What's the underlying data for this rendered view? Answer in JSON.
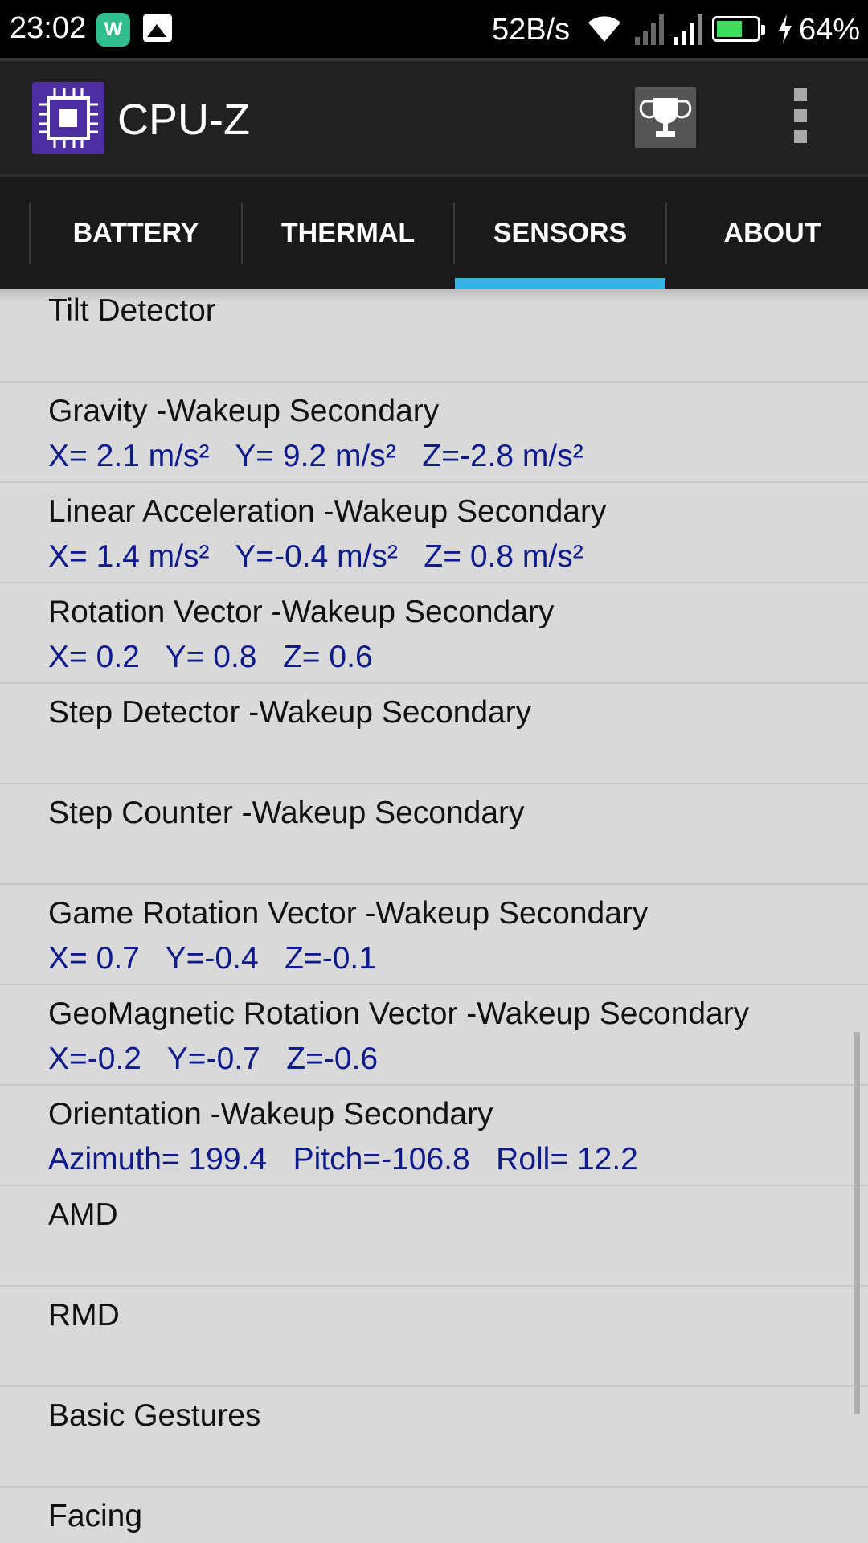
{
  "status_bar": {
    "time": "23:02",
    "network_speed": "52B/s",
    "battery_level": 0.64,
    "battery_percent": "64%",
    "icons": [
      "app-notification-icon",
      "image-notification-icon",
      "wifi-icon",
      "signal-icon",
      "signal-icon",
      "battery-icon",
      "charging-icon"
    ],
    "battery_color": "#3ddc5a"
  },
  "app_bar": {
    "title": "CPU-Z",
    "logo_color": "#4b2fa0",
    "icons": [
      "cpu-logo-icon",
      "trophy-icon",
      "overflow-menu-icon"
    ]
  },
  "tabs": {
    "items": [
      {
        "label": "BATTERY"
      },
      {
        "label": "THERMAL"
      },
      {
        "label": "SENSORS"
      },
      {
        "label": "ABOUT"
      }
    ],
    "selected": "SENSORS",
    "indicator_color": "#33b5e5"
  },
  "sensors": [
    {
      "name": "Tilt Detector",
      "values": ""
    },
    {
      "name": "Gravity -Wakeup Secondary",
      "values": "X= 2.1 m/s²   Y= 9.2 m/s²   Z=-2.8 m/s²"
    },
    {
      "name": "Linear Acceleration -Wakeup Secondary",
      "values": "X= 1.4 m/s²   Y=-0.4 m/s²   Z= 0.8 m/s²"
    },
    {
      "name": "Rotation Vector -Wakeup Secondary",
      "values": "X= 0.2   Y= 0.8   Z= 0.6"
    },
    {
      "name": "Step Detector -Wakeup Secondary",
      "values": ""
    },
    {
      "name": "Step Counter -Wakeup Secondary",
      "values": ""
    },
    {
      "name": "Game Rotation Vector -Wakeup Secondary",
      "values": "X= 0.7   Y=-0.4   Z=-0.1"
    },
    {
      "name": "GeoMagnetic Rotation Vector -Wakeup Secondary",
      "values": "X=-0.2   Y=-0.7   Z=-0.6"
    },
    {
      "name": "Orientation -Wakeup Secondary",
      "values": "Azimuth= 199.4   Pitch=-106.8   Roll= 12.2"
    },
    {
      "name": "AMD",
      "values": ""
    },
    {
      "name": "RMD",
      "values": ""
    },
    {
      "name": "Basic Gestures",
      "values": ""
    },
    {
      "name": "Facing",
      "values": ""
    }
  ],
  "colors": {
    "sensor_value": "#0d1b8c",
    "background": "#d9d9d9"
  }
}
